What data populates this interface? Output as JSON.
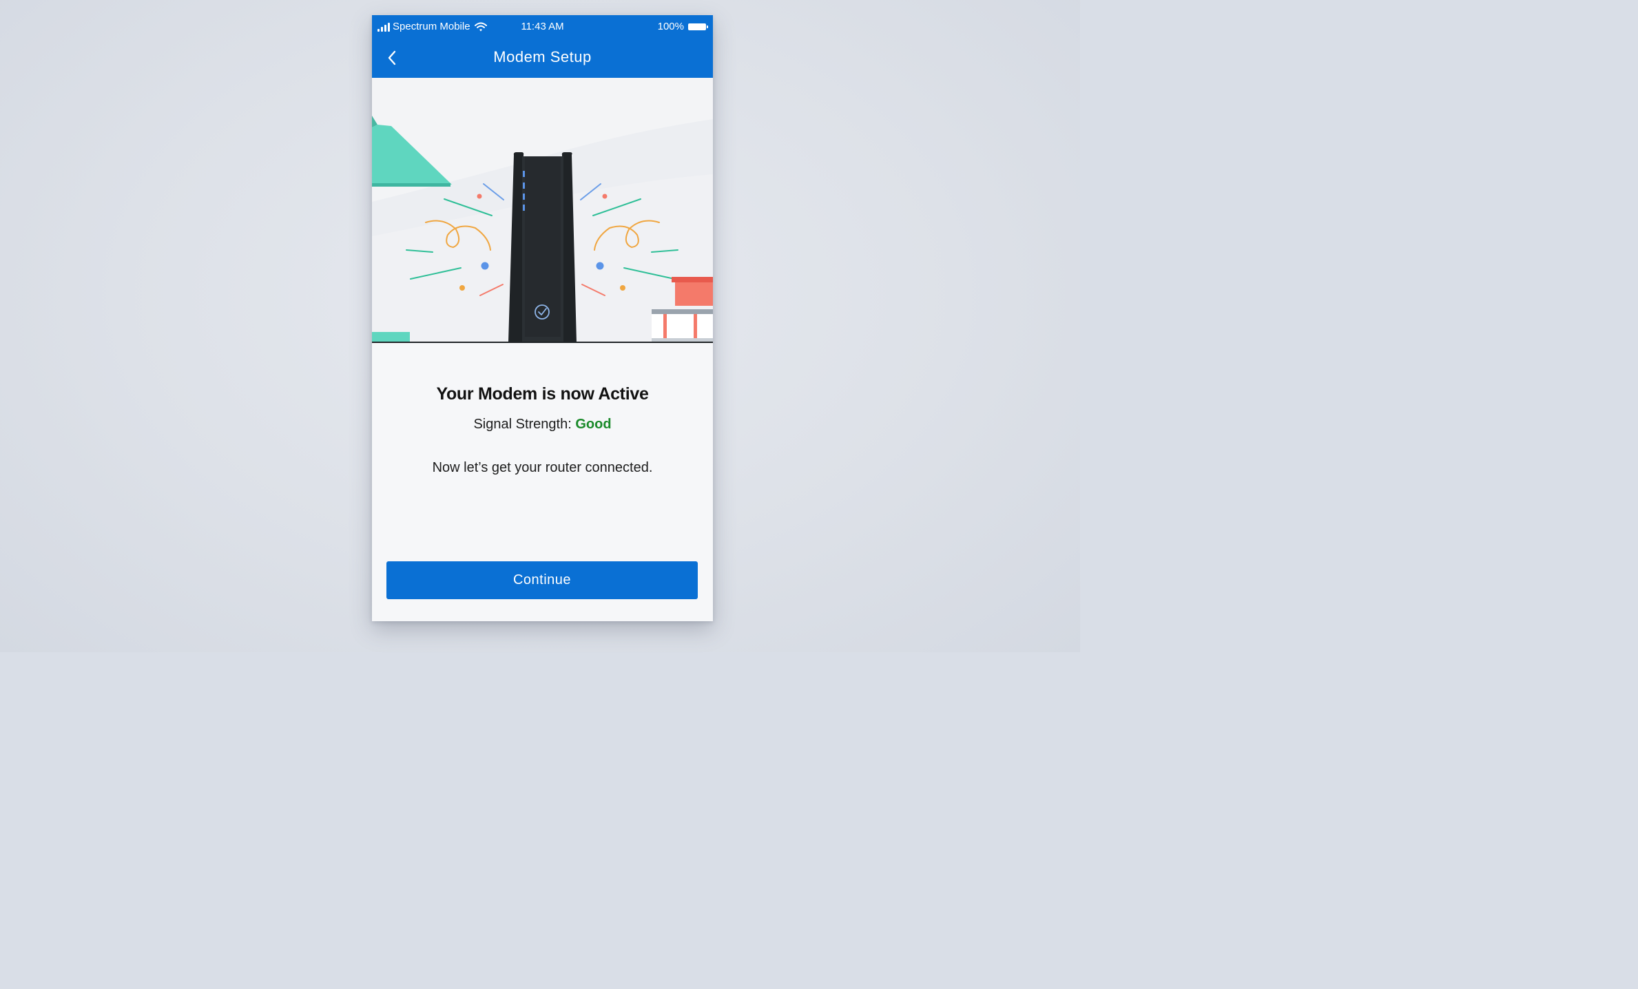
{
  "status_bar": {
    "carrier": "Spectrum Mobile",
    "time": "11:43 AM",
    "battery": "100%",
    "icons": [
      "signal-bars-icon",
      "wifi-icon",
      "battery-icon"
    ]
  },
  "nav": {
    "title": "Modem Setup",
    "back_icon": "chevron-left-icon"
  },
  "content": {
    "headline": "Your Modem is now Active",
    "signal_label": "Signal Strength: ",
    "signal_value": "Good",
    "subtext": "Now let’s get your router connected.",
    "continue_label": "Continue"
  },
  "colors": {
    "brand_blue": "#0a70d4",
    "status_good": "#1a8a2a",
    "lamp_teal": "#5fd6bf",
    "accent_red": "#f47a6a",
    "accent_orange": "#f0a640",
    "modem_dark": "#1f2326"
  }
}
